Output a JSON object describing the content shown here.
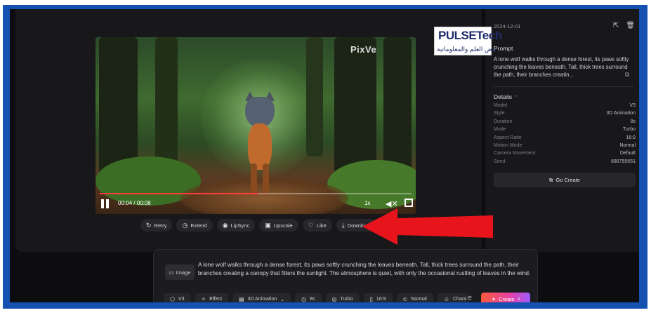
{
  "video": {
    "watermark": "PixVe",
    "time": "00:04 / 00:08",
    "speed": "1x",
    "progress": 0.51
  },
  "actions": [
    {
      "label": "Retry",
      "icon": "retry-icon"
    },
    {
      "label": "Extend",
      "icon": "extend-icon"
    },
    {
      "label": "LipSync",
      "icon": "lipsync-icon"
    },
    {
      "label": "Upscale",
      "icon": "upscale-icon"
    },
    {
      "label": "Like",
      "icon": "heart-icon"
    },
    {
      "label": "Download",
      "icon": "download-icon"
    }
  ],
  "sidebar": {
    "date": "2024-12-01",
    "prompt_title": "Prompt",
    "prompt_text": "A lone wolf walks through a dense forest, its paws softly crunching the leaves beneath. Tall, thick trees surround the path, their branches creatin...",
    "details_title": "Details",
    "details": [
      {
        "key": "Model",
        "value": "V3"
      },
      {
        "key": "Style",
        "value": "3D Animation"
      },
      {
        "key": "Duration",
        "value": "8s"
      },
      {
        "key": "Mode",
        "value": "Turbo"
      },
      {
        "key": "Aspect Ratio",
        "value": "16:9"
      },
      {
        "key": "Motion Mode",
        "value": "Normal"
      },
      {
        "key": "Camera Movement",
        "value": "Default"
      },
      {
        "key": "Seed",
        "value": "688755651"
      }
    ],
    "go_create": "Go Create"
  },
  "logo": {
    "title": "PULSETech",
    "subtitle": "نبض العلم والمعلوماتية"
  },
  "composer": {
    "image_label": "Image",
    "text": "A lone wolf walks through a dense forest, its paws softly crunching the leaves beneath. Tall, thick trees surround the path, their branches creating a canopy that filters the sunlight. The atmosphere is quiet, with only the occasional rustling of leaves in the wind.",
    "chips": [
      {
        "label": "V3",
        "icon": "cube-icon"
      },
      {
        "label": "Effect",
        "icon": "sparkle-icon"
      },
      {
        "label": "3D Animation",
        "icon": "style-icon"
      },
      {
        "label": "8s",
        "icon": "clock-icon"
      },
      {
        "label": "Turbo",
        "icon": "turbo-icon"
      },
      {
        "label": "16:9",
        "icon": "ratio-icon"
      },
      {
        "label": "Normal",
        "icon": "motion-icon"
      },
      {
        "label": "Chara",
        "icon": "character-icon"
      }
    ],
    "create_label": "Create",
    "create_cost": "4"
  },
  "colors": {
    "frame": "#1451b0",
    "accent_red": "#ff3b3b",
    "arrow_red": "#e8141c"
  }
}
